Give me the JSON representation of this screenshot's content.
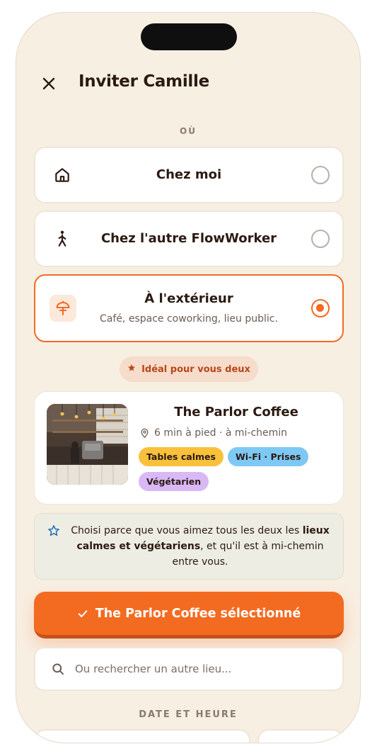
{
  "header": {
    "title": "Inviter Camille",
    "close_icon": "close-icon"
  },
  "where": {
    "label": "OÙ",
    "options": [
      {
        "icon": "home-icon",
        "title": "Chez moi",
        "subtitle": "",
        "selected": false
      },
      {
        "icon": "walking-person-icon",
        "title": "Chez l'autre FlowWorker",
        "subtitle": "",
        "selected": false
      },
      {
        "icon": "umbrella-table-icon",
        "title": "À l'extérieur",
        "subtitle": "Café, espace coworking, lieu public.",
        "selected": true
      }
    ]
  },
  "recommendation": {
    "badge": "Idéal pour vous deux",
    "place": {
      "name": "The Parlor Coffee",
      "meta": "6 min à pied · à mi-chemin",
      "tags": [
        {
          "label": "Tables calmes",
          "color": "#f9c13b"
        },
        {
          "label": "Wi-Fi · Prises",
          "color": "#7ec8f5"
        },
        {
          "label": "Végétarien",
          "color": "#d8b8f5"
        }
      ]
    },
    "reason": {
      "part1": "Choisi parce que vous aimez tous les deux les ",
      "bold": "lieux calmes et végétariens",
      "part2": ", et qu'il est à mi-chemin entre vous."
    }
  },
  "cta": {
    "label": "The Parlor Coffee sélectionné"
  },
  "search": {
    "placeholder": "Ou rechercher un autre lieu..."
  },
  "datetime": {
    "label": "DATE ET HEURE"
  },
  "colors": {
    "accent": "#f26b21",
    "background": "#f8efe3",
    "card": "#ffffff"
  }
}
